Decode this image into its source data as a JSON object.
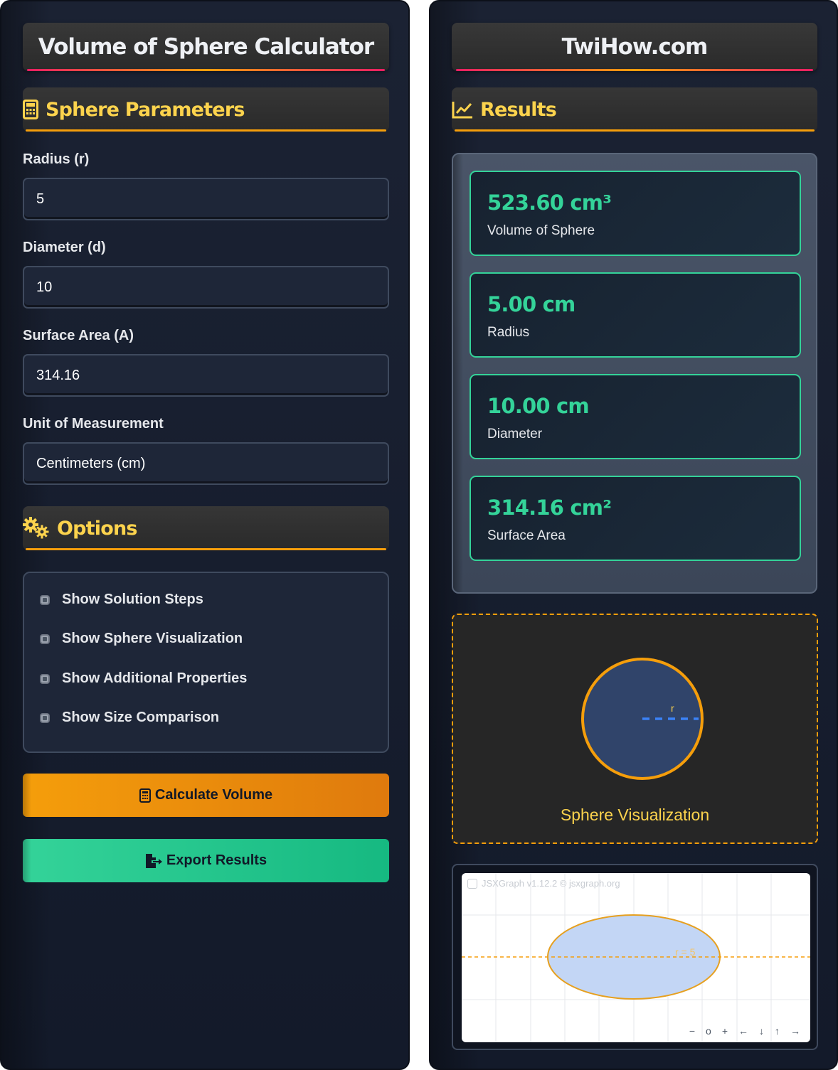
{
  "left": {
    "title": "Volume of Sphere Calculator",
    "params_heading": "Sphere Parameters",
    "fields": [
      {
        "label": "Radius (r)",
        "value": "5"
      },
      {
        "label": "Diameter (d)",
        "value": "10"
      },
      {
        "label": "Surface Area (A)",
        "value": "314.16"
      },
      {
        "label": "Unit of Measurement",
        "value": "Centimeters (cm)"
      }
    ],
    "options_heading": "Options",
    "options": [
      {
        "label": "Show Solution Steps"
      },
      {
        "label": "Show Sphere Visualization"
      },
      {
        "label": "Show Additional Properties"
      },
      {
        "label": "Show Size Comparison"
      }
    ],
    "calculate_label": "Calculate Volume",
    "export_label": "Export Results"
  },
  "right": {
    "title": "TwiHow.com",
    "results_heading": "Results",
    "results": [
      {
        "value": "523.60 cm³",
        "label": "Volume of Sphere"
      },
      {
        "value": "5.00 cm",
        "label": "Radius"
      },
      {
        "value": "10.00 cm",
        "label": "Diameter"
      },
      {
        "value": "314.16 cm²",
        "label": "Surface Area"
      }
    ],
    "viz": {
      "radius_label": "r",
      "caption": "Sphere Visualization"
    },
    "graph": {
      "credit": "JSXGraph v1.12.2 © jsxgraph.org",
      "radius_label": "r = 5",
      "nav": [
        "−",
        "o",
        "+",
        "←",
        "↓",
        "↑",
        "→"
      ]
    }
  },
  "colors": {
    "accent_orange": "#f59e0b",
    "accent_yellow": "#fcd34d",
    "accent_green": "#34d399",
    "accent_pink": "#e91e63",
    "panel_bg": "#1b2233"
  },
  "icons": {
    "params": "calculator-icon",
    "options": "gears-icon",
    "results": "chart-line-icon",
    "calculate": "calculator-icon",
    "export": "file-export-icon"
  }
}
